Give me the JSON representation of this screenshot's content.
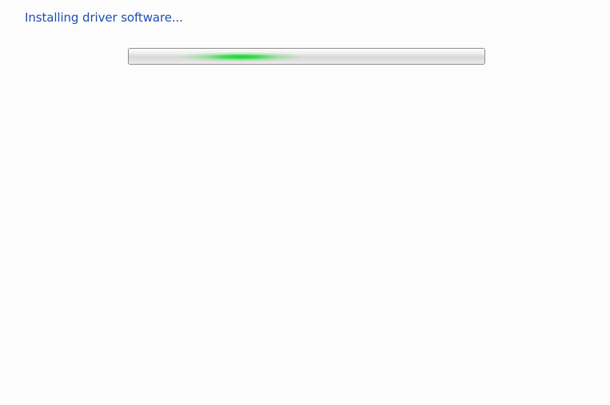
{
  "dialog": {
    "heading": "Installing driver software..."
  },
  "progress": {
    "mode": "indeterminate",
    "glow_color": "#14d628"
  }
}
